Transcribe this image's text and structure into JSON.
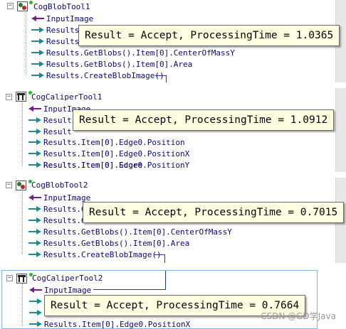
{
  "colors": {
    "input_arrow": "#7a1a8c",
    "output_arrow": "#1a8c8c",
    "tooltip_bg": "#ffffe1",
    "label_text": "#0a0a6e",
    "status_dot": "#22c022"
  },
  "panels": [
    {
      "tool_name": "CogBlobTool1",
      "icon": "blob-tool-icon",
      "input": "InputImage",
      "outputs": [
        "Results.",
        "Results.",
        "Results.GetBlobs().Item[0].CenterOfMassY",
        "Results.GetBlobs().Item[0].Area",
        "Results.CreateBlobImage()"
      ],
      "tooltip": "Result = Accept, ProcessingTime = 1.0365"
    },
    {
      "tool_name": "CogCaliperTool1",
      "icon": "caliper-tool-icon",
      "input": "InputImage",
      "outputs": [
        "Result",
        "Result",
        "Results.Item[0].Edge0.Position",
        "Results.Item[0].Edge0.PositionX",
        "Results.Item[0].Edge0.PositionY",
        "Results.Item[0].Score"
      ],
      "tooltip": "Result = Accept, ProcessingTime = 1.0912"
    },
    {
      "tool_name": "CogBlobTool2",
      "icon": "blob-tool-icon",
      "input": "InputImage",
      "outputs": [
        "Results.G",
        "Results.G",
        "Results.GetBlobs().Item[0].CenterOfMassY",
        "Results.GetBlobs().Item[0].Area",
        "Results.CreateBlobImage()"
      ],
      "tooltip": "Result = Accept, ProcessingTime = 0.7015"
    },
    {
      "tool_name": "CogCaliperTool2",
      "icon": "caliper-tool-icon",
      "input": "InputImage",
      "outputs": [
        "",
        "",
        "Results.Item[0].Edge0.PositionX"
      ],
      "tooltip": "Result = Accept, ProcessingTime = 0.7664"
    }
  ],
  "watermark": "CSDN @GD学Java"
}
